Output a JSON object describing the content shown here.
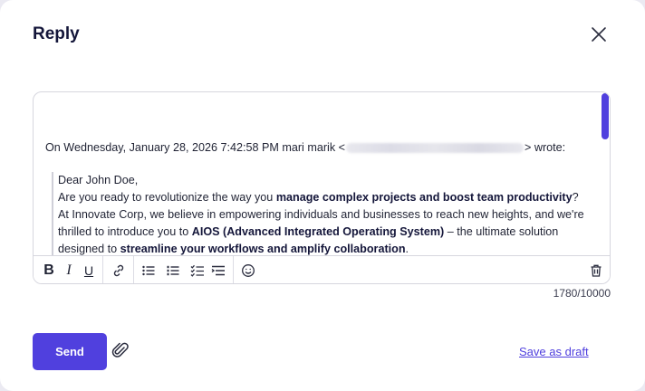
{
  "dialog": {
    "title": "Reply"
  },
  "editor": {
    "quote_header_prefix": "On Wednesday, January 28, 2026 7:42:58 PM mari marik <",
    "quote_header_suffix": "> wrote:",
    "greeting": "Dear John Doe,",
    "p1_a": "Are you ready to revolutionize the way you ",
    "p1_b": "manage complex projects and boost team productivity",
    "p1_c": "? At Innovate Corp, we believe in empowering individuals and businesses to reach new heights, and we're thrilled to introduce you to ",
    "p1_d": "AIOS (Advanced Integrated Operating System)",
    "p1_e": " – the ultimate solution designed to ",
    "p1_f": "streamline your workflows and amplify collaboration",
    "p1_g": "."
  },
  "toolbar": {
    "bold": "B",
    "italic": "I",
    "underline": "U",
    "icons": [
      "bold-icon",
      "italic-icon",
      "underline-icon",
      "link-icon",
      "bulleted-list-icon",
      "numbered-list-icon",
      "checklist-icon",
      "indent-list-icon",
      "emoji-icon",
      "trash-icon"
    ]
  },
  "counter": "1780/10000",
  "footer": {
    "send_label": "Send",
    "draft_label": "Save as draft"
  },
  "colors": {
    "accent": "#5040de",
    "title": "#14163a",
    "border": "#d6d6de"
  }
}
